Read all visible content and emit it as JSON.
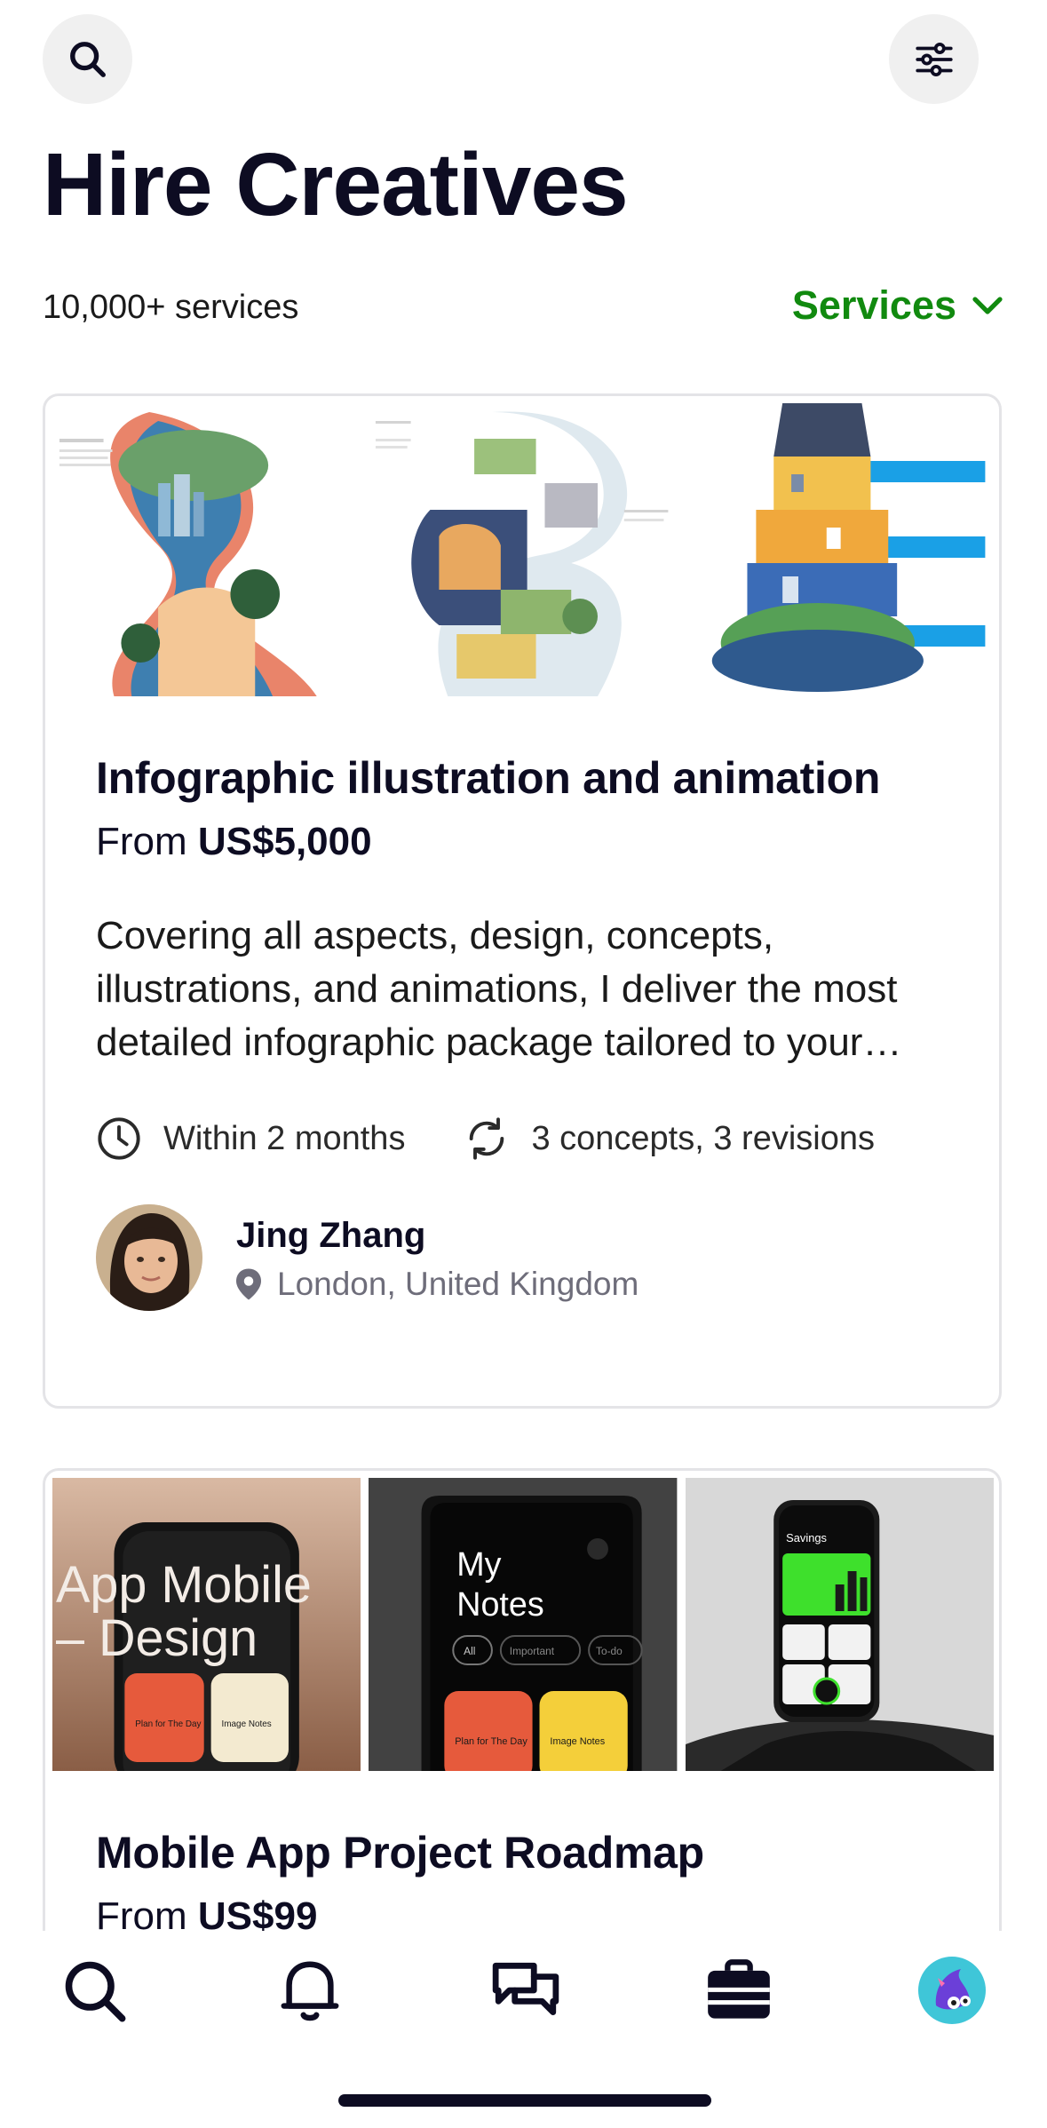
{
  "header": {
    "search_icon": "search-icon",
    "filter_icon": "sliders-icon",
    "title": "Hire Creatives",
    "count": "10,000+ services",
    "dropdown_label": "Services"
  },
  "colors": {
    "accent_green": "#118a0f",
    "text": "#0d0c22",
    "muted": "#6e6d7a",
    "border": "#e4e4e7"
  },
  "cards": [
    {
      "title": "Infographic illustration and animation",
      "price_prefix": "From",
      "price": "US$5,000",
      "description": "Covering all aspects, design, concepts, illustrations, and animations, I deliver the most detailed infographic package tailored to your…",
      "delivery": "Within 2 months",
      "revisions": "3 concepts, 3 revisions",
      "author_name": "Jing Zhang",
      "author_location": "London, United Kingdom"
    },
    {
      "title": "Mobile App Project Roadmap",
      "price_prefix": "From",
      "price": "US$99",
      "thumb_texts": {
        "t1_line1": "App Mobile",
        "t1_line2": "– Design",
        "t1_card_a": "Plan for The Day",
        "t1_card_b": "Image Notes",
        "t2_title_line1": "My",
        "t2_title_line2": "Notes",
        "t2_chip_all": "All",
        "t2_chip_important": "Important",
        "t2_chip_todo": "To-do",
        "t2_card_a": "Plan for The Day",
        "t2_card_b": "Image Notes",
        "t3_title": "Savings"
      }
    }
  ],
  "tabbar": {
    "items": [
      "search-icon",
      "bell-icon",
      "messages-icon",
      "briefcase-icon",
      "profile-avatar"
    ],
    "active": "briefcase-icon"
  }
}
